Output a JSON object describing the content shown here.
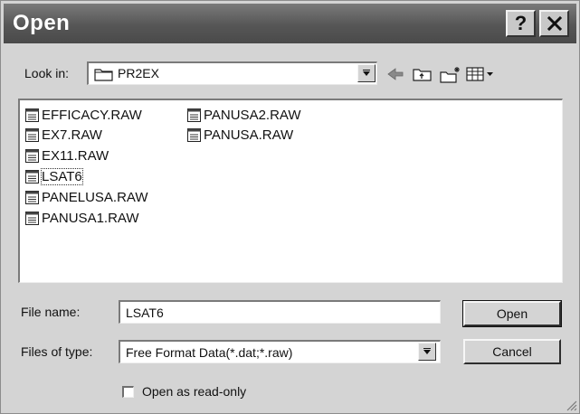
{
  "window": {
    "title": "Open"
  },
  "titlebar_buttons": {
    "help_glyph": "?"
  },
  "look_in": {
    "label": "Look in:",
    "value": "PR2EX"
  },
  "toolbar": {
    "icons": [
      "back-arrow-icon",
      "up-folder-icon",
      "new-folder-icon",
      "view-menu-icon"
    ]
  },
  "files": [
    {
      "name": "EFFICACY.RAW"
    },
    {
      "name": "EX7.RAW"
    },
    {
      "name": "EX11.RAW"
    },
    {
      "name": "LSAT6"
    },
    {
      "name": "PANELUSA.RAW"
    },
    {
      "name": "PANUSA1.RAW"
    },
    {
      "name": "PANUSA2.RAW"
    },
    {
      "name": "PANUSA.RAW"
    }
  ],
  "file_name": {
    "label": "File name:",
    "value": "LSAT6"
  },
  "file_type": {
    "label": "Files of type:",
    "value": "Free Format Data(*.dat;*.raw)"
  },
  "buttons": {
    "open": "Open",
    "cancel": "Cancel"
  },
  "read_only": {
    "label": "Open as read-only",
    "checked": false
  },
  "colors": {
    "titlebar": "#565656",
    "dialog_bg": "#d4d4d4",
    "field_bg": "#ffffff"
  }
}
